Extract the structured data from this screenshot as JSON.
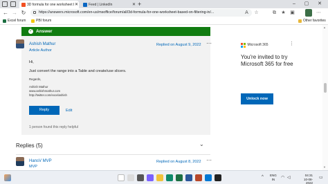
{
  "browser": {
    "tabs": [
      {
        "title": "3D formula for one worksheet b...",
        "active": true
      },
      {
        "title": "Feed | LinkedIn",
        "active": false
      }
    ],
    "url": "https://answers.microsoft.com/en-us/msoffice/forum/all/3d-formula-for-one-worksheet-based-on-filtering-in/...",
    "favorites": [
      "Excel forum",
      "PBI forum"
    ],
    "other_favorites": "Other favorites"
  },
  "answer": {
    "header": "Answer",
    "author": "Ashish Mathur",
    "role": "Article Author",
    "replied": "Replied on August 9, 2022",
    "greeting": "Hi,",
    "message": "Just convert the range into a Table and create/use slicers.",
    "regards": "Regards,",
    "signature": [
      "Ashish Mathur",
      "www.ashishmathur.com",
      "http://twitter.com/excelashish"
    ],
    "reply_label": "Reply",
    "edit_label": "Edit",
    "helpful": "1 person found this reply helpful"
  },
  "replies": {
    "title": "Replies (5)",
    "first": {
      "author": "HansV MVP",
      "role": "MVP",
      "replied": "Replied on August 8, 2022"
    }
  },
  "ad": {
    "brand": "Microsoft 365",
    "text": "You're invited to try Microsoft 365 for free",
    "button": "Unlock now"
  },
  "taskbar": {
    "lang_top": "ENG",
    "lang_bottom": "IN",
    "time": "04:31",
    "date": "10-08-2022"
  }
}
